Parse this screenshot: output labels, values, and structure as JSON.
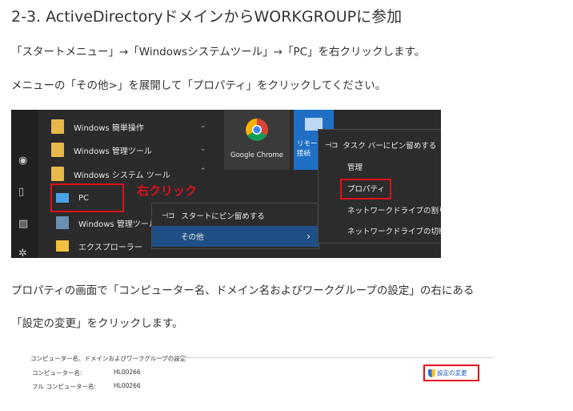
{
  "heading": "2-3. ActiveDirectoryドメインからWORKGROUPに参加",
  "para1": "「スタートメニュー」→「Windowsシステムツール」→「PC」を右クリックします。",
  "para2": "メニューの「その他>」を展開して「プロパティ」をクリックしてください。",
  "para3": "プロパティの画面で「コンピューター名、ドメイン名およびワークグループの設定」の右にある",
  "para4": "「設定の変更」をクリックします。",
  "startmenu": {
    "items": [
      "Windows 簡単操作",
      "Windows 管理ツール",
      "Windows システム ツール",
      "PC",
      "Windows 管理ツール",
      "エクスプローラー"
    ],
    "annotation": "右クリック",
    "tile_chrome": "Google Chrome",
    "tile_remote_1": "リモート",
    "tile_remote_2": "接続",
    "ctx1": [
      "スタートにピン留めする",
      "その他"
    ],
    "ctx2": [
      "タスク バーにピン留めする",
      "管理",
      "プロパティ",
      "ネットワークドライブの割り当て",
      "ネットワークドライブの切断"
    ],
    "colors": {
      "annotation": "#e0101a",
      "highlight": "#1f4f86"
    }
  },
  "settings": {
    "section_title": "コンピューター名、ドメインおよびワークグループの設定",
    "computer_name_label": "コンピューター名:",
    "computer_name_value": "HL00266",
    "full_name_label": "フル コンピューター名:",
    "full_name_value": "HL00266",
    "change_link": "設定の変更"
  }
}
